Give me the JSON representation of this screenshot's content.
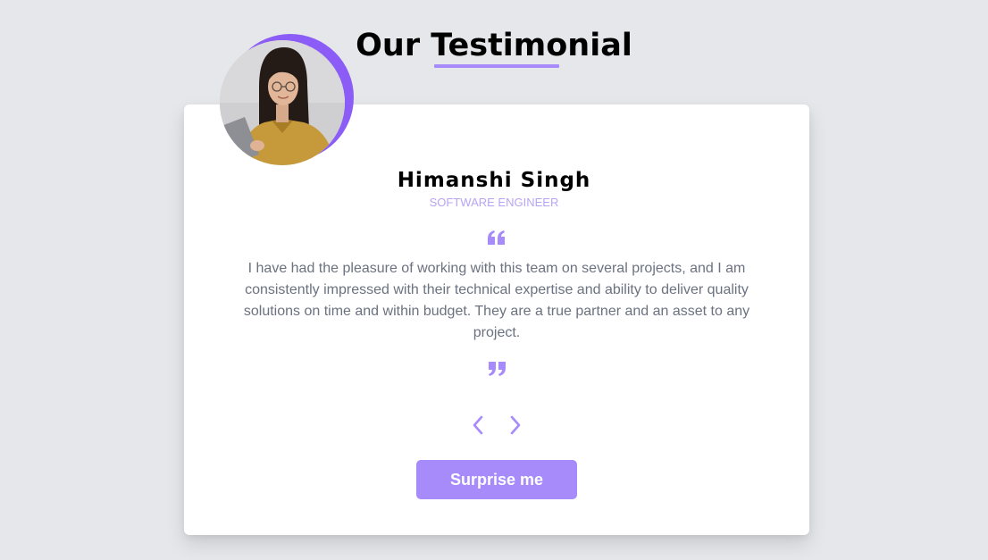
{
  "header": {
    "title": "Our Testimonial"
  },
  "testimonial": {
    "name": "Himanshi Singh",
    "job": "SOFTWARE ENGINEER",
    "text": "I have had the pleasure of working with this team on several projects, and I am consistently impressed with their technical expertise and ability to deliver quality solutions on time and within budget. They are a true partner and an asset to any project."
  },
  "icons": {
    "open_quote": "quote-left-icon",
    "close_quote": "quote-right-icon",
    "prev": "chevron-left-icon",
    "next": "chevron-right-icon",
    "avatar": "person-photo"
  },
  "button": {
    "surprise_label": "Surprise me"
  },
  "colors": {
    "background": "#e5e7eb",
    "card": "#ffffff",
    "accent": "#a78bfa",
    "accent_dark": "#8b5cf6",
    "job": "#b8a4f5",
    "text": "#6b7280"
  }
}
